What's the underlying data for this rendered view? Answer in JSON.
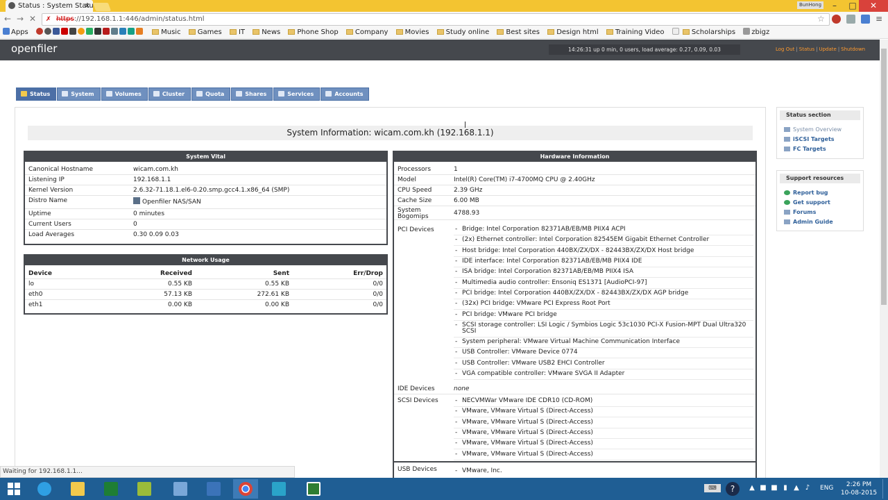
{
  "browser": {
    "tab_title": "Status : System Status",
    "tab_close": "×",
    "profile": "BunHong",
    "url_insecure": "https",
    "url_rest": "://192.168.1.1:446/admin/status.html",
    "bookmarks": [
      "Apps",
      "Music",
      "Games",
      "IT",
      "News",
      "Phone Shop",
      "Company",
      "Movies",
      "Study online",
      "Best sites",
      "Design html",
      "Training Video",
      "Scholarships",
      "zbigz"
    ],
    "status_text": "Waiting for 192.168.1.1..."
  },
  "header": {
    "logo": "openfiler",
    "uptime": "14:26:31 up 0 min, 0 users, load average: 0.27, 0.09, 0.03",
    "links": [
      "Log Out",
      "Status",
      "Update",
      "Shutdown"
    ]
  },
  "nav_tabs": [
    "Status",
    "System",
    "Volumes",
    "Cluster",
    "Quota",
    "Shares",
    "Services",
    "Accounts"
  ],
  "page_title": "System Information: wicam.com.kh (192.168.1.1)",
  "system_vital": {
    "title": "System Vital",
    "rows": [
      {
        "k": "Canonical Hostname",
        "v": "wicam.com.kh"
      },
      {
        "k": "Listening IP",
        "v": "192.168.1.1"
      },
      {
        "k": "Kernel Version",
        "v": "2.6.32-71.18.1.el6-0.20.smp.gcc4.1.x86_64 (SMP)"
      },
      {
        "k": "Distro Name",
        "v": "Openfiler NAS/SAN"
      },
      {
        "k": "Uptime",
        "v": "0 minutes"
      },
      {
        "k": "Current Users",
        "v": "0"
      },
      {
        "k": "Load Averages",
        "v": "0.30 0.09 0.03"
      }
    ]
  },
  "network_usage": {
    "title": "Network Usage",
    "headers": [
      "Device",
      "Received",
      "Sent",
      "Err/Drop"
    ],
    "rows": [
      [
        "lo",
        "0.55 KB",
        "0.55 KB",
        "0/0"
      ],
      [
        "eth0",
        "57.13 KB",
        "272.61 KB",
        "0/0"
      ],
      [
        "eth1",
        "0.00 KB",
        "0.00 KB",
        "0/0"
      ]
    ]
  },
  "hardware": {
    "title": "Hardware Information",
    "rows": [
      {
        "k": "Processors",
        "v": "1"
      },
      {
        "k": "Model",
        "v": "Intel(R) Core(TM) i7-4700MQ CPU @ 2.40GHz"
      },
      {
        "k": "CPU Speed",
        "v": "2.39 GHz"
      },
      {
        "k": "Cache Size",
        "v": "6.00 MB"
      },
      {
        "k": "System Bogomips",
        "v": "4788.93"
      }
    ],
    "pci_label": "PCI Devices",
    "pci": [
      "Bridge: Intel Corporation 82371AB/EB/MB PIIX4 ACPI",
      "(2x) Ethernet controller: Intel Corporation 82545EM Gigabit Ethernet Controller",
      "Host bridge: Intel Corporation 440BX/ZX/DX - 82443BX/ZX/DX Host bridge",
      "IDE interface: Intel Corporation 82371AB/EB/MB PIIX4 IDE",
      "ISA bridge: Intel Corporation 82371AB/EB/MB PIIX4 ISA",
      "Multimedia audio controller: Ensoniq ES1371 [AudioPCI-97]",
      "PCI bridge: Intel Corporation 440BX/ZX/DX - 82443BX/ZX/DX AGP bridge",
      "(32x) PCI bridge: VMware PCI Express Root Port",
      "PCI bridge: VMware PCI bridge",
      "SCSI storage controller: LSI Logic / Symbios Logic 53c1030 PCI-X Fusion-MPT Dual Ultra320 SCSI",
      "System peripheral: VMware Virtual Machine Communication Interface",
      "USB Controller: VMware Device 0774",
      "USB Controller: VMware USB2 EHCI Controller",
      "VGA compatible controller: VMware SVGA II Adapter"
    ],
    "ide_label": "IDE Devices",
    "ide_value": "none",
    "scsi_label": "SCSI Devices",
    "scsi": [
      "NECVMWar VMware IDE CDR10 (CD-ROM)",
      "VMware, VMware Virtual S (Direct-Access)",
      "VMware, VMware Virtual S (Direct-Access)",
      "VMware, VMware Virtual S (Direct-Access)",
      "VMware, VMware Virtual S (Direct-Access)",
      "VMware, VMware Virtual S (Direct-Access)"
    ],
    "usb_label": "USB Devices",
    "usb": [
      "VMware, Inc."
    ]
  },
  "sidebar": {
    "status_title": "Status section",
    "status_links": [
      "System Overview",
      "iSCSI Targets",
      "FC Targets"
    ],
    "support_title": "Support resources",
    "support_links": [
      "Report bug",
      "Get support",
      "Forums",
      "Admin Guide"
    ]
  },
  "taskbar": {
    "lang": "ENG",
    "time": "2:26 PM",
    "date": "10-08-2015"
  },
  "colors": {
    "header": "#45484d",
    "tab": "#6f90bf",
    "link": "#2e5f99",
    "accent": "#ff9a2e"
  }
}
